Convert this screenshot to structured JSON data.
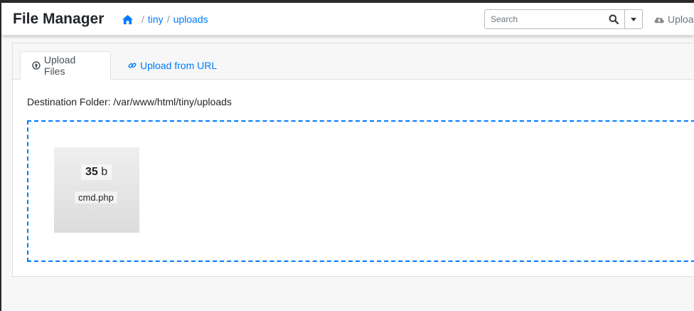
{
  "app": {
    "title": "File Manager"
  },
  "breadcrumb": {
    "items": [
      "tiny",
      "uploads"
    ],
    "separator": "/"
  },
  "search": {
    "placeholder": "Search",
    "value": ""
  },
  "nav": {
    "upload_label": "Upload"
  },
  "tabs": [
    {
      "label": "Upload Files",
      "icon": "arrow-circle-up-icon",
      "active": true
    },
    {
      "label": "Upload from URL",
      "icon": "link-icon",
      "active": false
    }
  ],
  "destination": {
    "label": "Destination Folder: /var/www/html/tiny/uploads"
  },
  "file": {
    "size_value": "35",
    "size_unit": "b",
    "name": "cmd.php"
  },
  "colors": {
    "accent": "#007bff",
    "dropzone_border": "#007bff",
    "text": "#212529",
    "muted": "#6c757d"
  }
}
